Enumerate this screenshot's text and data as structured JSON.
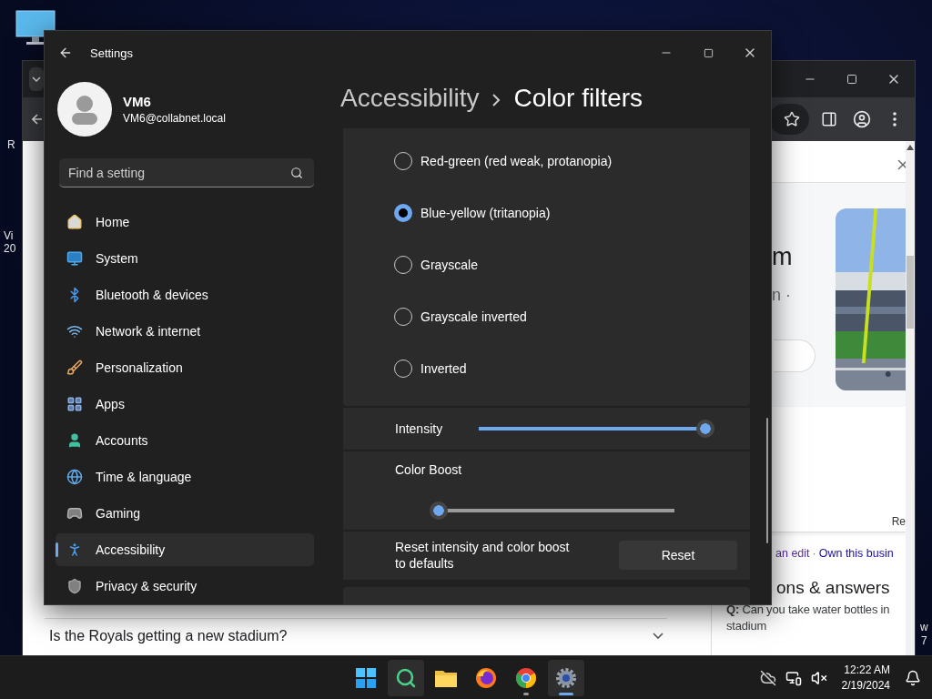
{
  "desktop": {
    "labels": [
      "R",
      "Vi",
      "20",
      "w",
      "7"
    ]
  },
  "browser": {
    "faq": {
      "question": "Is the Royals getting a new stadium?",
      "expanded": false
    },
    "panel": {
      "title": "m",
      "subtitle": "n ·"
    },
    "review_fragment": "Re",
    "links": [
      {
        "label": "an edit",
        "visited": true
      },
      {
        "label": "Own this busin",
        "visited": false
      }
    ],
    "link_separator": "·",
    "qa": {
      "heading": "ons & answers",
      "question_lines": [
        "**Q:** Can you take water bottles in",
        "stadium"
      ]
    }
  },
  "settings": {
    "title": "Settings",
    "user": {
      "name": "VM6",
      "email": "VM6@collabnet.local"
    },
    "search": {
      "placeholder": "Find a setting"
    },
    "nav": [
      {
        "kind": "home",
        "label": "Home",
        "selected": false
      },
      {
        "kind": "system",
        "label": "System",
        "selected": false
      },
      {
        "kind": "bluetooth",
        "label": "Bluetooth & devices",
        "selected": false
      },
      {
        "kind": "network",
        "label": "Network & internet",
        "selected": false
      },
      {
        "kind": "personalization",
        "label": "Personalization",
        "selected": false
      },
      {
        "kind": "apps",
        "label": "Apps",
        "selected": false
      },
      {
        "kind": "accounts",
        "label": "Accounts",
        "selected": false
      },
      {
        "kind": "time",
        "label": "Time & language",
        "selected": false
      },
      {
        "kind": "gaming",
        "label": "Gaming",
        "selected": false
      },
      {
        "kind": "accessibility",
        "label": "Accessibility",
        "selected": true
      },
      {
        "kind": "privacy",
        "label": "Privacy & security",
        "selected": false
      }
    ],
    "breadcrumb": [
      "Accessibility",
      "Color filters"
    ],
    "filters": [
      {
        "label": "Red-green (red weak, protanopia)",
        "selected": false
      },
      {
        "label": "Blue-yellow (tritanopia)",
        "selected": true
      },
      {
        "label": "Grayscale",
        "selected": false
      },
      {
        "label": "Grayscale inverted",
        "selected": false
      },
      {
        "label": "Inverted",
        "selected": false
      }
    ],
    "intensity": {
      "label": "Intensity",
      "level": 1
    },
    "color_boost": {
      "label": "Color Boost",
      "level": 0
    },
    "reset": {
      "text": "Reset intensity and color boost to defaults",
      "button": "Reset"
    }
  },
  "taskbar": {
    "apps": [
      {
        "kind": "start",
        "highlighted": false,
        "running": false,
        "focused": false
      },
      {
        "kind": "search",
        "highlighted": true,
        "running": false,
        "focused": false
      },
      {
        "kind": "files",
        "highlighted": false,
        "running": false,
        "focused": false
      },
      {
        "kind": "firefox",
        "highlighted": false,
        "running": false,
        "focused": false
      },
      {
        "kind": "chrome",
        "highlighted": false,
        "running": true,
        "focused": false
      },
      {
        "kind": "settings",
        "highlighted": true,
        "running": true,
        "focused": true
      }
    ],
    "clock": {
      "time": "12:22 AM",
      "date": "2/19/2024"
    }
  }
}
